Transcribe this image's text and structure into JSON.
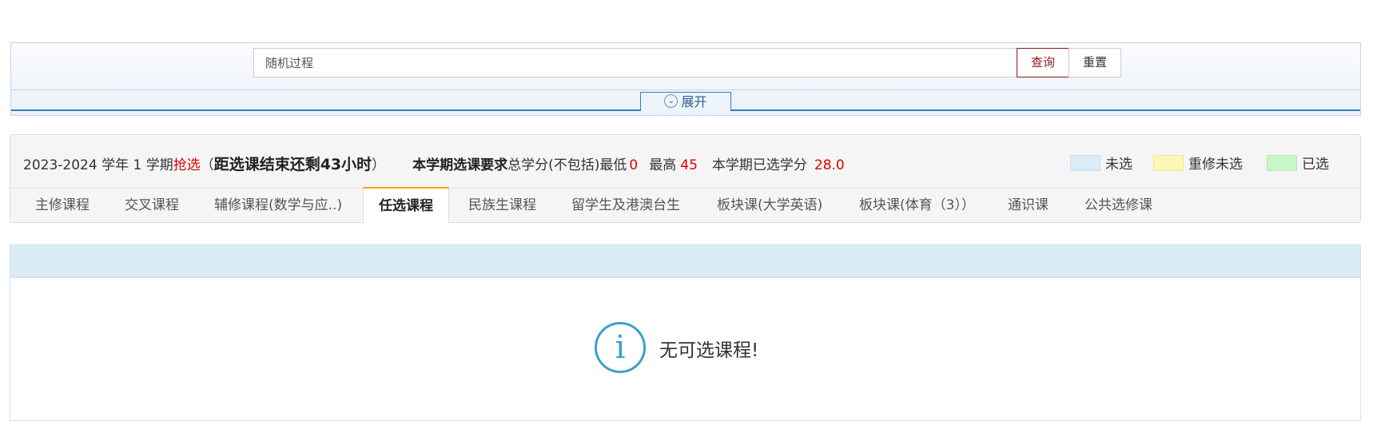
{
  "search": {
    "value": "随机过程",
    "query_label": "查询",
    "reset_label": "重置",
    "expand_icon": "chevron-down-circle-icon",
    "expand_label": "展开"
  },
  "info": {
    "term": "2023-2024 学年 1 学期",
    "phase": "抢选",
    "paren_open": "（",
    "countdown": "距选课结束还剩43小时",
    "paren_close": "）",
    "req_label": "本学期选课要求",
    "req_text": "总学分(不包括)最低",
    "min_value": "0",
    "max_label": "最高",
    "max_value": "45",
    "selected_label": "本学期已选学分",
    "selected_value": "28.0"
  },
  "legend": [
    {
      "label": "未选",
      "color": "#daecf6"
    },
    {
      "label": "重修未选",
      "color": "#fdf6b5"
    },
    {
      "label": "已选",
      "color": "#c7f7c7"
    }
  ],
  "tabs": [
    {
      "label": "主修课程"
    },
    {
      "label": "交叉课程"
    },
    {
      "label": "辅修课程(数学与应..)"
    },
    {
      "label": "任选课程",
      "active": true
    },
    {
      "label": "民族生课程"
    },
    {
      "label": "留学生及港澳台生"
    },
    {
      "label": "板块课(大学英语)"
    },
    {
      "label": "板块课(体育（3））"
    },
    {
      "label": "通识课"
    },
    {
      "label": "公共选修课"
    }
  ],
  "result": {
    "icon": "info-icon",
    "icon_glyph": "i",
    "message": "无可选课程!"
  },
  "colors": {
    "accent_red": "#e00000",
    "active_tab_border": "#f0a30a",
    "info_icon": "#3aa1cc"
  }
}
